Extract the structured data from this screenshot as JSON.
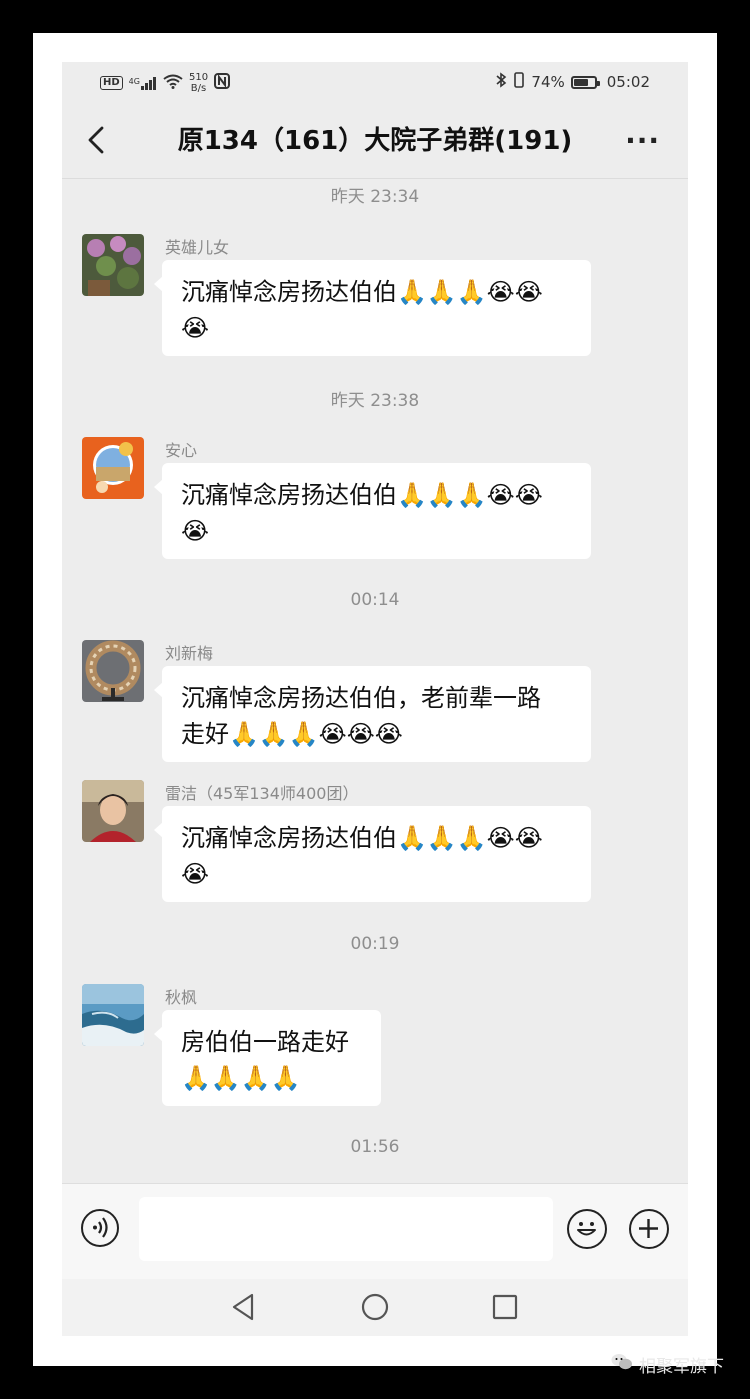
{
  "status_bar": {
    "hd": "HD",
    "network": "4G",
    "speed_value": "510",
    "speed_unit": "B/s",
    "battery": "74%",
    "battery_level": 0.74,
    "clock": "05:02"
  },
  "header": {
    "title": "原134（161）大院子弟群(191)",
    "more": "···"
  },
  "timestamps": [
    "昨天 23:34",
    "昨天 23:38",
    "00:14",
    "00:19",
    "01:56"
  ],
  "messages": [
    {
      "sender": "英雄儿女",
      "text_line1": "沉痛悼念房扬达伯伯🙏🙏🙏😭😭",
      "text_line2": "😭"
    },
    {
      "sender": "安心",
      "text_line1": "沉痛悼念房扬达伯伯🙏🙏🙏😭😭",
      "text_line2": "😭"
    },
    {
      "sender": "刘新梅",
      "text_line1": "沉痛悼念房扬达伯伯，老前辈一路",
      "text_line2": "走好🙏🙏🙏😭😭😭"
    },
    {
      "sender": "雷洁（45军134师400团）",
      "text_line1": "沉痛悼念房扬达伯伯🙏🙏🙏😭😭",
      "text_line2": "😭"
    },
    {
      "sender": "秋枫",
      "text_line1": "房伯伯一路走好",
      "text_line2": "🙏🙏🙏🙏"
    }
  ],
  "input": {
    "placeholder": ""
  },
  "icons": {
    "voice": "voice-icon",
    "emoji": "emoji-icon",
    "plus": "plus-icon",
    "back": "back-arrow-icon"
  },
  "watermark": "相聚军旗下"
}
